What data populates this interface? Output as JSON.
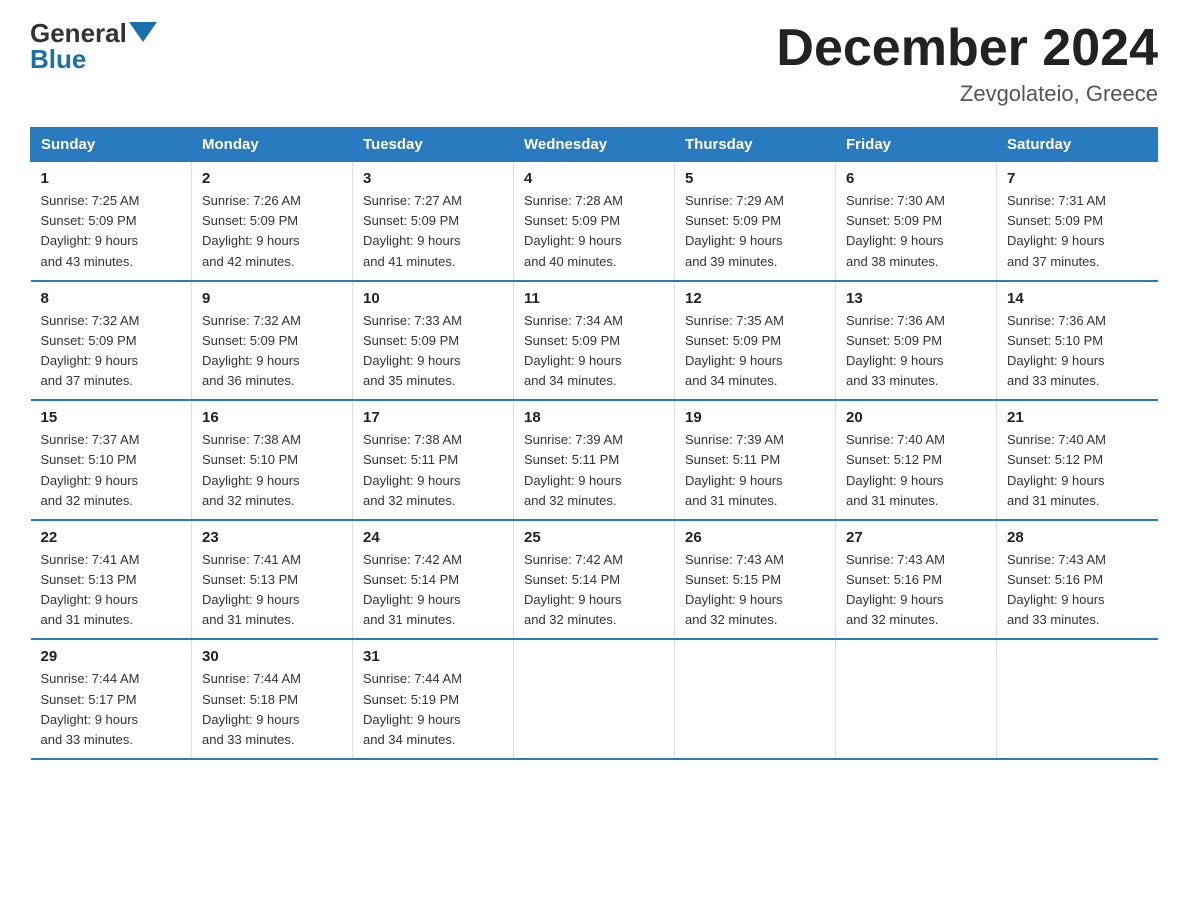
{
  "logo": {
    "general": "General",
    "blue": "Blue"
  },
  "title": "December 2024",
  "subtitle": "Zevgolateio, Greece",
  "headers": [
    "Sunday",
    "Monday",
    "Tuesday",
    "Wednesday",
    "Thursday",
    "Friday",
    "Saturday"
  ],
  "weeks": [
    [
      {
        "day": "1",
        "sunrise": "7:25 AM",
        "sunset": "5:09 PM",
        "daylight": "9 hours and 43 minutes."
      },
      {
        "day": "2",
        "sunrise": "7:26 AM",
        "sunset": "5:09 PM",
        "daylight": "9 hours and 42 minutes."
      },
      {
        "day": "3",
        "sunrise": "7:27 AM",
        "sunset": "5:09 PM",
        "daylight": "9 hours and 41 minutes."
      },
      {
        "day": "4",
        "sunrise": "7:28 AM",
        "sunset": "5:09 PM",
        "daylight": "9 hours and 40 minutes."
      },
      {
        "day": "5",
        "sunrise": "7:29 AM",
        "sunset": "5:09 PM",
        "daylight": "9 hours and 39 minutes."
      },
      {
        "day": "6",
        "sunrise": "7:30 AM",
        "sunset": "5:09 PM",
        "daylight": "9 hours and 38 minutes."
      },
      {
        "day": "7",
        "sunrise": "7:31 AM",
        "sunset": "5:09 PM",
        "daylight": "9 hours and 37 minutes."
      }
    ],
    [
      {
        "day": "8",
        "sunrise": "7:32 AM",
        "sunset": "5:09 PM",
        "daylight": "9 hours and 37 minutes."
      },
      {
        "day": "9",
        "sunrise": "7:32 AM",
        "sunset": "5:09 PM",
        "daylight": "9 hours and 36 minutes."
      },
      {
        "day": "10",
        "sunrise": "7:33 AM",
        "sunset": "5:09 PM",
        "daylight": "9 hours and 35 minutes."
      },
      {
        "day": "11",
        "sunrise": "7:34 AM",
        "sunset": "5:09 PM",
        "daylight": "9 hours and 34 minutes."
      },
      {
        "day": "12",
        "sunrise": "7:35 AM",
        "sunset": "5:09 PM",
        "daylight": "9 hours and 34 minutes."
      },
      {
        "day": "13",
        "sunrise": "7:36 AM",
        "sunset": "5:09 PM",
        "daylight": "9 hours and 33 minutes."
      },
      {
        "day": "14",
        "sunrise": "7:36 AM",
        "sunset": "5:10 PM",
        "daylight": "9 hours and 33 minutes."
      }
    ],
    [
      {
        "day": "15",
        "sunrise": "7:37 AM",
        "sunset": "5:10 PM",
        "daylight": "9 hours and 32 minutes."
      },
      {
        "day": "16",
        "sunrise": "7:38 AM",
        "sunset": "5:10 PM",
        "daylight": "9 hours and 32 minutes."
      },
      {
        "day": "17",
        "sunrise": "7:38 AM",
        "sunset": "5:11 PM",
        "daylight": "9 hours and 32 minutes."
      },
      {
        "day": "18",
        "sunrise": "7:39 AM",
        "sunset": "5:11 PM",
        "daylight": "9 hours and 32 minutes."
      },
      {
        "day": "19",
        "sunrise": "7:39 AM",
        "sunset": "5:11 PM",
        "daylight": "9 hours and 31 minutes."
      },
      {
        "day": "20",
        "sunrise": "7:40 AM",
        "sunset": "5:12 PM",
        "daylight": "9 hours and 31 minutes."
      },
      {
        "day": "21",
        "sunrise": "7:40 AM",
        "sunset": "5:12 PM",
        "daylight": "9 hours and 31 minutes."
      }
    ],
    [
      {
        "day": "22",
        "sunrise": "7:41 AM",
        "sunset": "5:13 PM",
        "daylight": "9 hours and 31 minutes."
      },
      {
        "day": "23",
        "sunrise": "7:41 AM",
        "sunset": "5:13 PM",
        "daylight": "9 hours and 31 minutes."
      },
      {
        "day": "24",
        "sunrise": "7:42 AM",
        "sunset": "5:14 PM",
        "daylight": "9 hours and 31 minutes."
      },
      {
        "day": "25",
        "sunrise": "7:42 AM",
        "sunset": "5:14 PM",
        "daylight": "9 hours and 32 minutes."
      },
      {
        "day": "26",
        "sunrise": "7:43 AM",
        "sunset": "5:15 PM",
        "daylight": "9 hours and 32 minutes."
      },
      {
        "day": "27",
        "sunrise": "7:43 AM",
        "sunset": "5:16 PM",
        "daylight": "9 hours and 32 minutes."
      },
      {
        "day": "28",
        "sunrise": "7:43 AM",
        "sunset": "5:16 PM",
        "daylight": "9 hours and 33 minutes."
      }
    ],
    [
      {
        "day": "29",
        "sunrise": "7:44 AM",
        "sunset": "5:17 PM",
        "daylight": "9 hours and 33 minutes."
      },
      {
        "day": "30",
        "sunrise": "7:44 AM",
        "sunset": "5:18 PM",
        "daylight": "9 hours and 33 minutes."
      },
      {
        "day": "31",
        "sunrise": "7:44 AM",
        "sunset": "5:19 PM",
        "daylight": "9 hours and 34 minutes."
      },
      null,
      null,
      null,
      null
    ]
  ],
  "labels": {
    "sunrise": "Sunrise:",
    "sunset": "Sunset:",
    "daylight": "Daylight:"
  }
}
